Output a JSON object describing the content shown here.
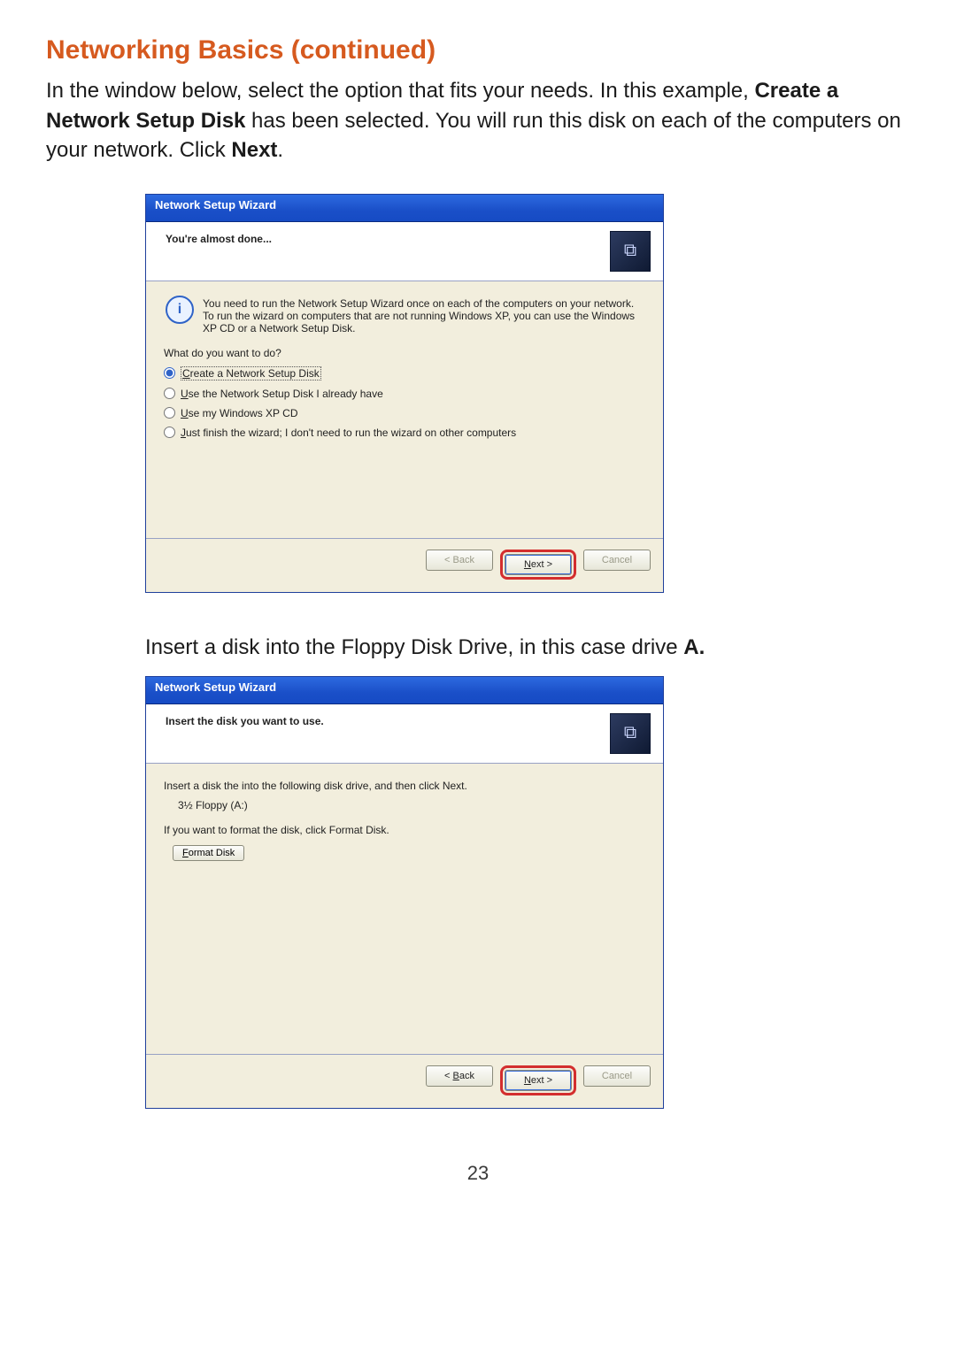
{
  "page": {
    "heading": "Networking Basics (continued)",
    "para1_a": "In the window below, select the option that fits your needs.  In this example, ",
    "para1_b": "Create a Network Setup Disk",
    "para1_c": " has been selected.  You will run this disk on each of the computers on your network. Click ",
    "para1_d": "Next",
    "para1_e": ".",
    "mid_a": "Insert a disk into the Floppy Disk Drive, in this case drive ",
    "mid_b": "A.",
    "page_number": "23"
  },
  "wizard1": {
    "title": "Network Setup Wizard",
    "header": "You're almost done...",
    "info_text": "You need to run the Network Setup Wizard once on each of the computers on your network. To run the wizard on computers that are not running Windows XP, you can use the Windows XP CD or a Network Setup Disk.",
    "prompt": "What do you want to do?",
    "options": [
      {
        "label_pre": "C",
        "label_rest": "reate a Network Setup Disk",
        "selected": true,
        "dotted": true
      },
      {
        "label_pre": "U",
        "label_rest": "se the Network Setup Disk I already have",
        "selected": false,
        "dotted": false
      },
      {
        "label_pre": "U",
        "label_rest": "se my Windows XP CD",
        "selected": false,
        "dotted": false
      },
      {
        "label_pre": "J",
        "label_rest": "ust finish the wizard; I don't need to run the wizard on other computers",
        "selected": false,
        "dotted": false
      }
    ],
    "buttons": {
      "back": "< Back",
      "next": "Next >",
      "cancel": "Cancel"
    },
    "back_enabled": false,
    "cancel_enabled": false,
    "highlight_next": true
  },
  "wizard2": {
    "title": "Network Setup Wizard",
    "header": "Insert the disk you want to use.",
    "line1": "Insert a disk the into the following disk drive, and then click Next.",
    "drive": "3½ Floppy (A:)",
    "line2": "If you want to format the disk, click Format Disk.",
    "format_btn_pre": "F",
    "format_btn_rest": "ormat Disk",
    "buttons": {
      "back": "< Back",
      "next": "Next >",
      "cancel": "Cancel"
    },
    "back_enabled": true,
    "cancel_enabled": false,
    "highlight_next": true
  }
}
